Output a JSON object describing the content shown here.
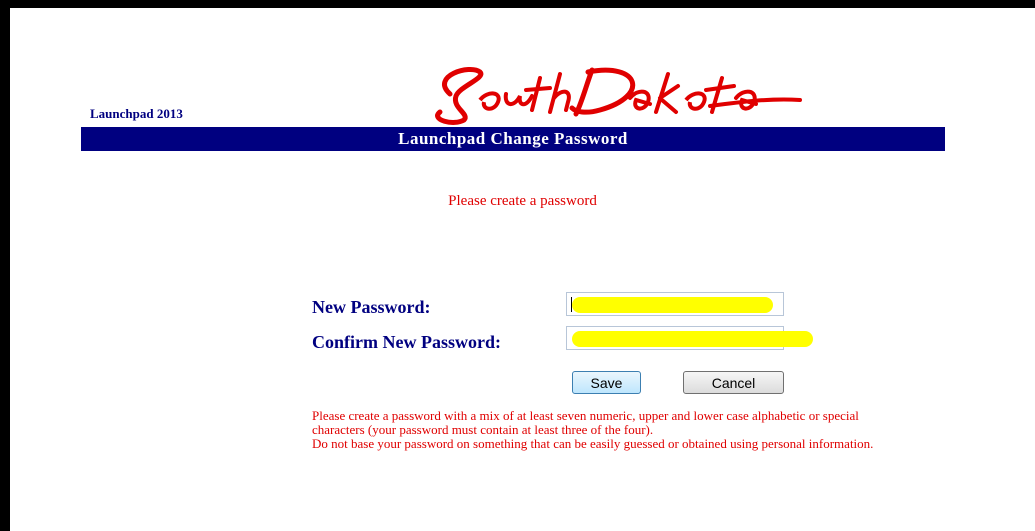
{
  "app": {
    "name": "Launchpad 2013",
    "logo_text": "SouthDakota"
  },
  "header": {
    "title": "Launchpad Change Password"
  },
  "prompt": "Please create a password",
  "form": {
    "new_password_label": "New Password:",
    "confirm_password_label": "Confirm New Password:",
    "new_password_value": "",
    "confirm_password_value": ""
  },
  "buttons": {
    "save": "Save",
    "cancel": "Cancel"
  },
  "notes": {
    "rule1": "Please create a password with a mix of at least seven numeric, upper and lower case alphabetic or special characters (your password must contain at least three of the four).",
    "rule2": "Do not base your password on something that can be easily guessed or obtained using personal information."
  },
  "colors": {
    "banner": "#000080",
    "accent_red": "#e00000",
    "highlight": "#ffff00"
  }
}
